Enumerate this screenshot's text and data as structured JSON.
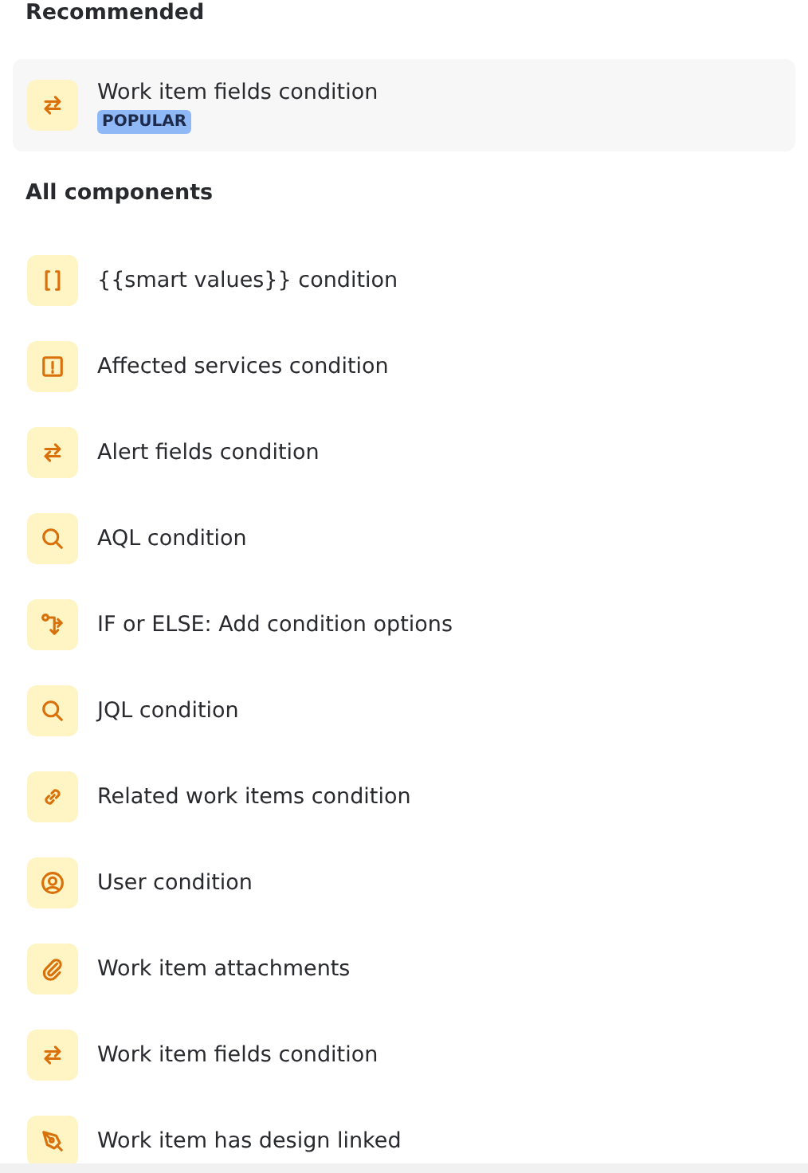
{
  "recommended": {
    "heading": "Recommended",
    "items": [
      {
        "label": "Work item fields condition",
        "badge": "POPULAR",
        "kind": "swap"
      }
    ]
  },
  "all_components": {
    "heading": "All components",
    "items": [
      {
        "label": "{{smart values}} condition",
        "kind": "braces"
      },
      {
        "label": "Affected services condition",
        "kind": "alert"
      },
      {
        "label": "Alert fields condition",
        "kind": "swap"
      },
      {
        "label": "AQL condition",
        "kind": "search"
      },
      {
        "label": "IF or ELSE: Add condition options",
        "kind": "branch"
      },
      {
        "label": "JQL condition",
        "kind": "search"
      },
      {
        "label": "Related work items condition",
        "kind": "link"
      },
      {
        "label": "User condition",
        "kind": "user"
      },
      {
        "label": "Work item attachments",
        "kind": "clip"
      },
      {
        "label": "Work item fields condition",
        "kind": "swap"
      },
      {
        "label": "Work item has design linked",
        "kind": "pen"
      }
    ]
  }
}
